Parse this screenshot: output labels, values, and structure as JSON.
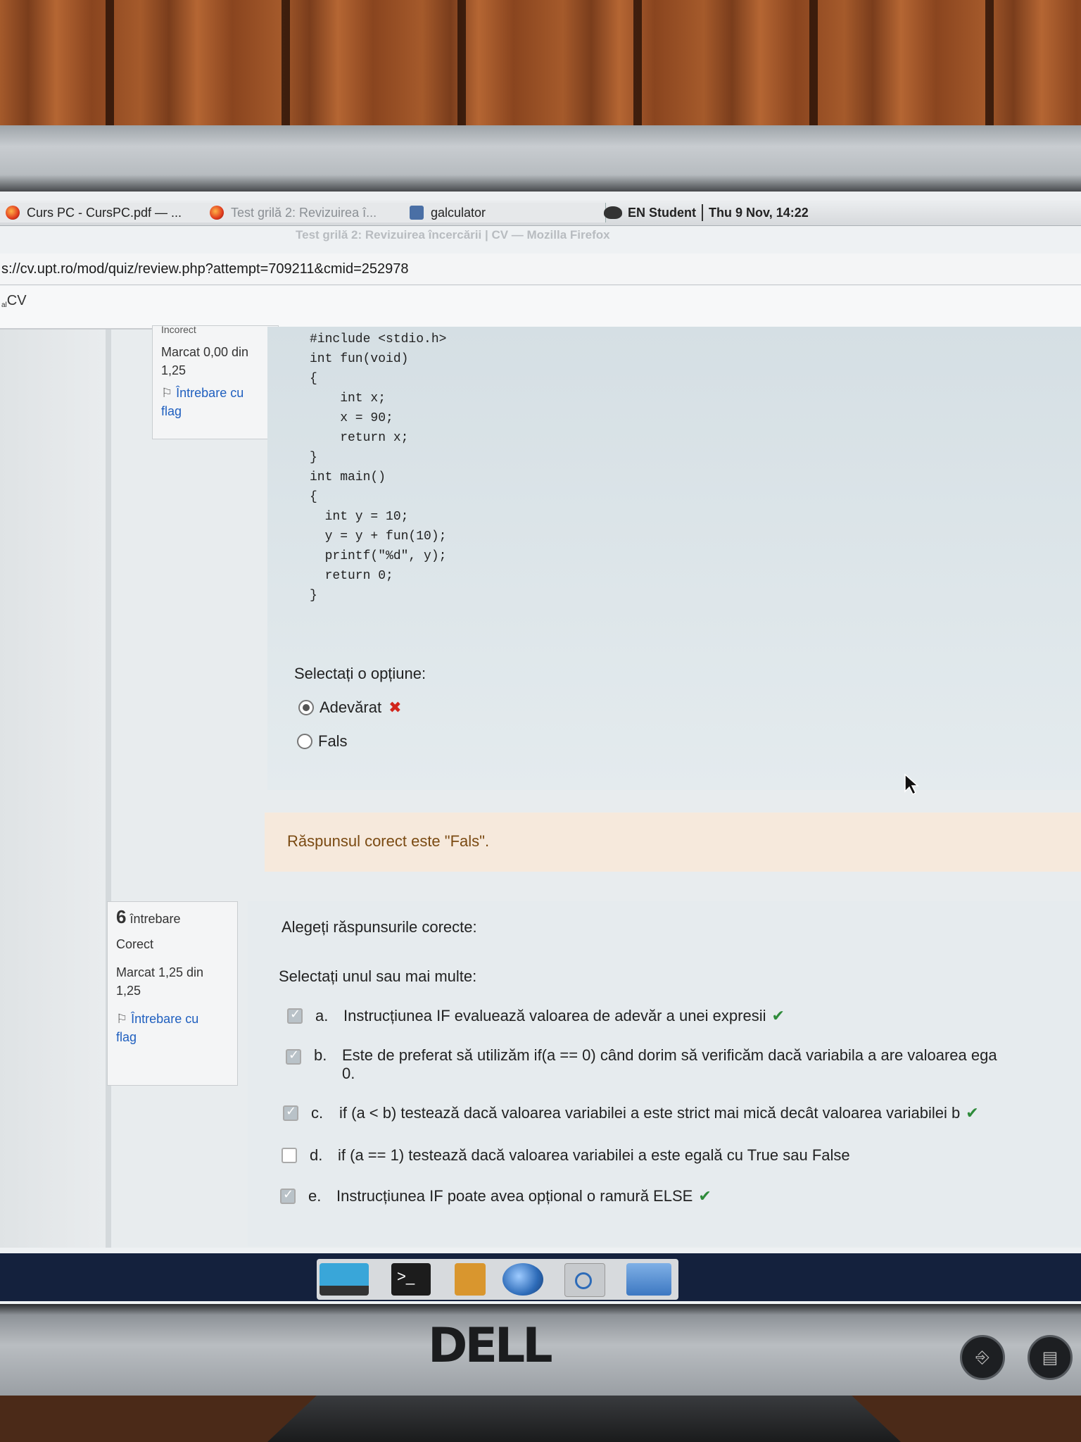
{
  "taskbar": {
    "tabs": [
      {
        "label": "Curs PC - CursPC.pdf — ...",
        "icon": "firefox-icon"
      },
      {
        "label": "Test grilă 2: Revizuirea î...",
        "icon": "firefox-icon"
      },
      {
        "label": "galculator",
        "icon": "calculator-icon"
      }
    ],
    "keyboard": "EN",
    "user": "Student",
    "clock": "Thu  9 Nov, 14:22"
  },
  "window_title": "Test grilă 2: Revizuirea încercării | CV — Mozilla Firefox",
  "url": "s://cv.upt.ro/mod/quiz/review.php?attempt=709211&cmid=252978",
  "site_logo": "CV",
  "q5": {
    "state_partial": "Incorect",
    "mark": "Marcat 0,00 din",
    "mark_total": "1,25",
    "flag_label": "Întrebare cu",
    "flag_label2": "flag",
    "code_lines": [
      "#include <stdio.h>",
      "int fun(void)",
      "{",
      "    int x;",
      "    x = 90;",
      "    return x;",
      "}",
      "int main()",
      "{",
      "  int y = 10;",
      "  y = y + fun(10);",
      "  printf(\"%d\", y);",
      "  return 0;",
      "}"
    ],
    "prompt": "Selectați o opțiune:",
    "options": [
      {
        "label": "Adevărat",
        "selected": true
      },
      {
        "label": "Fals",
        "selected": false
      }
    ],
    "feedback": "Răspunsul corect este \"Fals\"."
  },
  "q6": {
    "number": "6",
    "number_label": "întrebare",
    "state": "Corect",
    "mark": "Marcat 1,25 din",
    "mark_total": "1,25",
    "flag_label": "Întrebare cu",
    "flag_label2": "flag",
    "question": "Alegeți răspunsurile corecte:",
    "prompt": "Selectați unul sau mai multe:",
    "options": [
      {
        "letter": "a.",
        "text": "Instrucțiunea IF evaluează valoarea de adevăr a unei expresii",
        "checked": true,
        "correct": true
      },
      {
        "letter": "b.",
        "text": "Este de preferat să utilizăm if(a == 0) când dorim să verificăm dacă variabila a are valoarea ega",
        "text2": "0.",
        "checked": true,
        "correct": false
      },
      {
        "letter": "c.",
        "text": "if (a < b) testează dacă valoarea variabilei a este strict mai mică decât valoarea variabilei b",
        "checked": true,
        "correct": true
      },
      {
        "letter": "d.",
        "text": "if (a == 1) testează dacă valoarea variabilei a este egală cu True sau False",
        "checked": false,
        "correct": false
      },
      {
        "letter": "e.",
        "text": "Instrucțiunea IF poate avea opțional o ramură ELSE",
        "checked": true,
        "correct": true
      }
    ]
  },
  "brand": "DELL",
  "colors": {
    "incorrect": "#d1261c",
    "correct": "#2e8b3a",
    "link": "#1f5fbf"
  }
}
